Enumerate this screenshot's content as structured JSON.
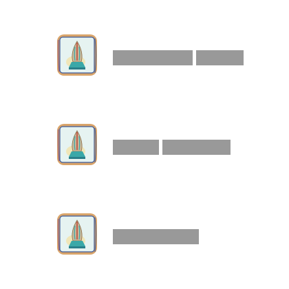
{
  "items": [
    {
      "icon": "pen-nib-icon",
      "text_blocks": 2
    },
    {
      "icon": "pen-nib-icon",
      "text_blocks": 2
    },
    {
      "icon": "pen-nib-icon",
      "text_blocks": 1
    }
  ],
  "colors": {
    "background": "#ffffff",
    "placeholder_bar": "#999999",
    "frame_border": "#d9a46a",
    "frame_fill": "#dff0ee",
    "nib_teal": "#3aa8a8",
    "nib_red": "#c0392b"
  }
}
